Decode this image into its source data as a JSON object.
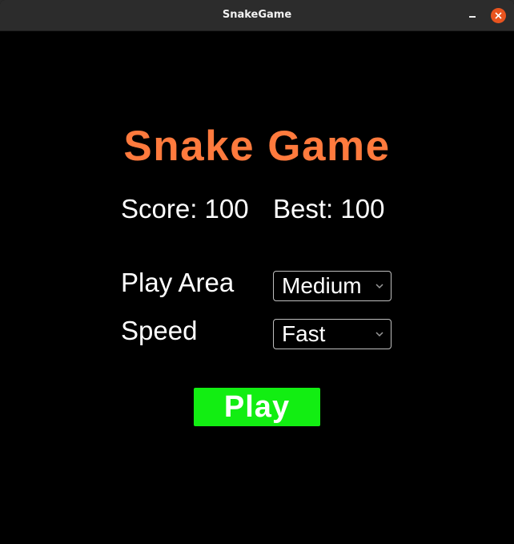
{
  "window": {
    "title": "SnakeGame"
  },
  "game": {
    "title": "Snake Game",
    "score_text": "Score: 100",
    "best_text": "Best: 100",
    "play_area_label": "Play Area",
    "play_area_value": "Medium",
    "speed_label": "Speed",
    "speed_value": "Fast",
    "play_label": "Play"
  },
  "icons": {
    "minimize": "minimize-icon",
    "close": "close-icon",
    "dropdown": "chevron-down-icon"
  },
  "colors": {
    "title": "#ff7a3d",
    "play_button": "#12ee12",
    "close_button": "#e9541f",
    "background": "#000000"
  }
}
